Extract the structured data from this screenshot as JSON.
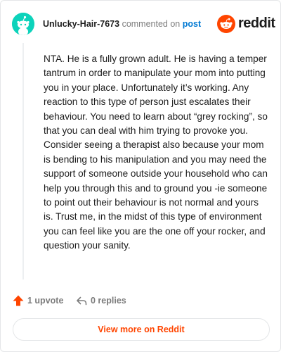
{
  "header": {
    "username": "Unlucky-Hair-7673",
    "commented_text": "commented on",
    "post_link": "post",
    "brand_name": "reddit"
  },
  "comment": {
    "body": "NTA. He is a fully grown adult. He is having a temper tantrum in order to manipulate your mom into putting you in your place. Unfortunately it’s working. Any reaction to this type of person just escalates their behaviour. You need to learn about “grey rocking”, so that you can deal with him trying to provoke you. Consider seeing a therapist also because your mom is bending to his manipulation and you may need the support of someone outside your household who can help you through this and to ground you -ie someone to point out their behaviour is not normal and yours is. Trust me, in the midst of this type of environment you can feel like you are the one off your rocker, and question your sanity."
  },
  "actions": {
    "upvote_label": "1 upvote",
    "replies_label": "0 replies"
  },
  "footer": {
    "view_more_label": "View more on Reddit"
  },
  "colors": {
    "avatar_background": "#0dd3bb",
    "reddit_orange": "#ff4500",
    "link_blue": "#0079d3",
    "muted_text": "#7c7c7c"
  },
  "icons": {
    "avatar": "snoo-avatar-icon",
    "brand": "reddit-logo-icon",
    "upvote": "upvote-arrow-icon",
    "replies": "reply-arrow-icon"
  }
}
